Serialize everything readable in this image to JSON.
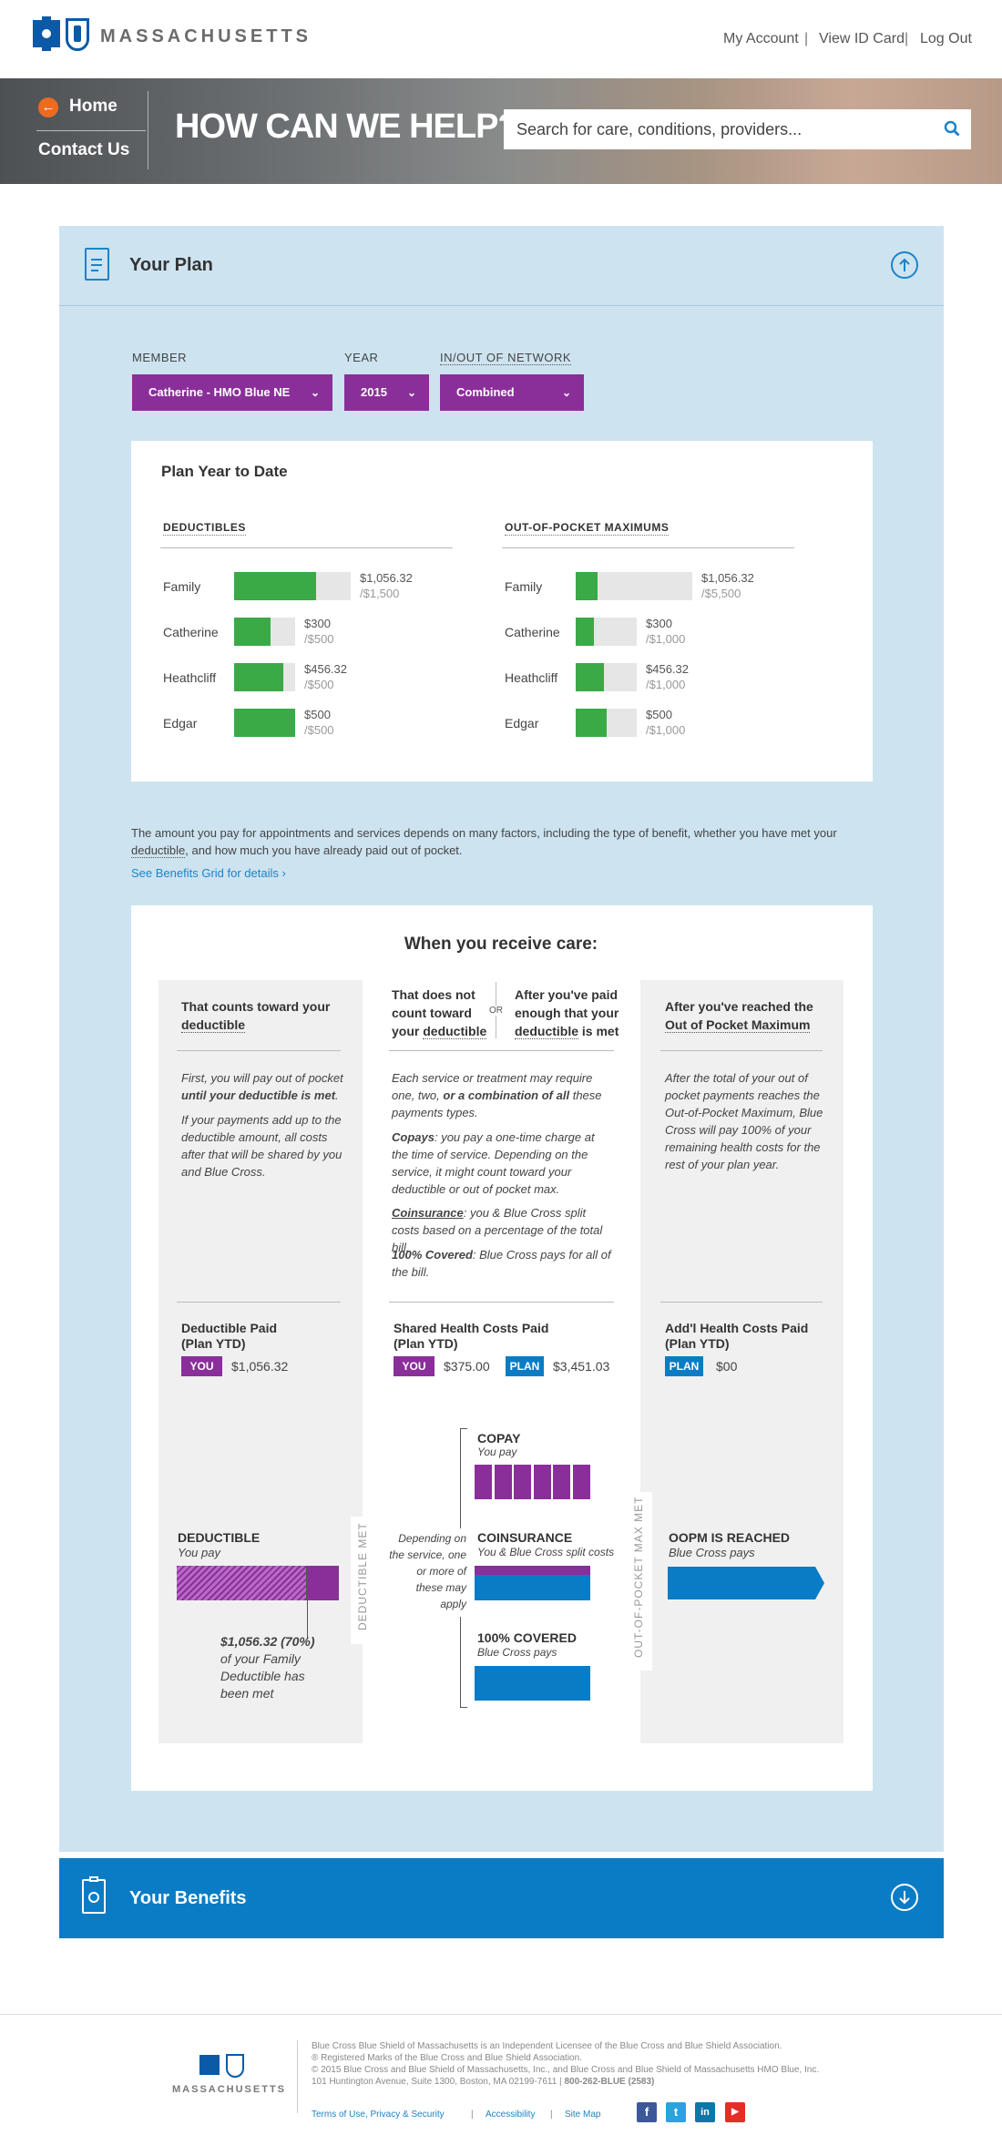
{
  "header": {
    "brand": "MASSACHUSETTS",
    "links": [
      "My Account",
      "View ID Card",
      "Log Out"
    ]
  },
  "hero": {
    "nav_home": "Home",
    "nav_contact": "Contact Us",
    "title": "HOW CAN WE HELP?",
    "search_placeholder": "Search for care, conditions, providers..."
  },
  "plan": {
    "title": "Your Plan",
    "filters": {
      "member_label": "MEMBER",
      "member_value": "Catherine - HMO Blue NE",
      "year_label": "YEAR",
      "year_value": "2015",
      "network_label": "IN/OUT OF NETWORK",
      "network_value": "Combined"
    },
    "ytd": {
      "title": "Plan Year to Date",
      "deductibles_title": "DEDUCTIBLES",
      "oop_title": "OUT-OF-POCKET MAXIMUMS",
      "deductibles": [
        {
          "name": "Family",
          "amount": "$1,056.32",
          "limit": "/$1,500",
          "fraction": 0.704
        },
        {
          "name": "Catherine",
          "amount": "$300",
          "limit": "/$500",
          "fraction": 0.6
        },
        {
          "name": "Heathcliff",
          "amount": "$456.32",
          "limit": "/$500",
          "fraction": 0.8
        },
        {
          "name": "Edgar",
          "amount": "$500",
          "limit": "/$500",
          "fraction": 1.0
        }
      ],
      "oop": [
        {
          "name": "Family",
          "amount": "$1,056.32",
          "limit": "/$5,500",
          "fraction": 0.19
        },
        {
          "name": "Catherine",
          "amount": "$300",
          "limit": "/$1,000",
          "fraction": 0.3
        },
        {
          "name": "Heathcliff",
          "amount": "$456.32",
          "limit": "/$1,000",
          "fraction": 0.46
        },
        {
          "name": "Edgar",
          "amount": "$500",
          "limit": "/$1,000",
          "fraction": 0.5
        }
      ]
    },
    "description_1": "The amount you pay for appointments and services depends on many factors, including the type of benefit, whether you have met your",
    "description_2_deductible": "deductible",
    "description_2_rest": ", and how much you have already paid out of pocket.",
    "benefits_link": "See Benefits Grid for details ›"
  },
  "care": {
    "title": "When you receive care:",
    "col1": {
      "head_1": "That counts toward your",
      "head_2": "deductible",
      "text_1a": "First, you will pay out of pocket",
      "text_1b": "until your deductible is met",
      "text_1c": ".",
      "text_2": "If your payments add up to the deductible amount, all costs after that will be shared by you and Blue Cross.",
      "paid_title_1": "Deductible Paid",
      "paid_title_2": "(Plan YTD)",
      "badge_you": "YOU",
      "you_value": "$1,056.32"
    },
    "col2": {
      "head_a1": "That does not",
      "head_a2": "count toward",
      "head_a3": "your",
      "head_a4": "deductible",
      "or": "OR",
      "head_b1": "After you've paid",
      "head_b2": "enough that your",
      "head_b3": "deductible",
      "head_b4": "is met",
      "text_1": "Each service or treatment may require one, two,",
      "text_1b": "or a combination of all",
      "text_1c": "these payments types.",
      "copays_label": "Copays",
      "copays_text": ": you pay a one-time charge at the time of service. Depending on the service, it might count toward your deductible or out of pocket max.",
      "coins_label": "Coinsurance",
      "coins_text": ": you & Blue Cross split costs based on a percentage of the total bill.",
      "covered_label": "100% Covered",
      "covered_text": ": Blue Cross pays for all of the bill.",
      "paid_title_1": "Shared Health Costs Paid",
      "paid_title_2": "(Plan YTD)",
      "badge_you": "YOU",
      "you_value": "$375.00",
      "badge_plan": "PLAN",
      "plan_value": "$3,451.03"
    },
    "col3": {
      "head_1": "After you've reached the",
      "head_2": "Out of Pocket Maximum",
      "text": "After the total of your out of pocket payments reaches the Out-of-Pocket Maximum, Blue Cross will pay 100% of your remaining health costs for the rest of your plan year.",
      "paid_title_1": "Add'l Health Costs Paid",
      "paid_title_2": "(Plan YTD)",
      "badge_plan": "PLAN",
      "plan_value": "$00"
    },
    "diagram": {
      "deductible_title": "DEDUCTIBLE",
      "deductible_sub": "You pay",
      "deductible_fraction": 0.8,
      "deductible_note_1": "$1,056.32 (70%)",
      "deductible_note_2": "of your Family",
      "deductible_note_3": "Deductible has",
      "deductible_note_4": "been met",
      "deductible_met_label": "DEDUCTIBLE MET",
      "depending_1": "Depending on",
      "depending_2": "the service, one",
      "depending_3": "or more of",
      "depending_4": "these may",
      "depending_5": "apply",
      "copay_title": "COPAY",
      "copay_sub": "You pay",
      "coins_title": "COINSURANCE",
      "coins_sub": "You & Blue Cross split costs",
      "covered_title": "100% COVERED",
      "covered_sub": "Blue Cross pays",
      "oop_met_label": "OUT-OF-POCKET MAX MET",
      "oopm_title": "OOPM IS REACHED",
      "oopm_sub": "Blue Cross pays"
    }
  },
  "benefits": {
    "title": "Your Benefits"
  },
  "footer": {
    "brand": "MASSACHUSETTS",
    "line_1": "Blue Cross Blue Shield of Massachusetts is an Independent Licensee of the Blue Cross and Blue Shield Association.",
    "line_2": "® Registered Marks of the Blue Cross and Blue Shield Association.",
    "line_3": "© 2015 Blue Cross and Blue Shield of Massachusetts, Inc., and Blue Cross and Blue Shield of Massachusetts HMO Blue, Inc.",
    "line_4": "101 Huntington Avenue, Suite 1300, Boston, MA 02199-7611 |",
    "phone": "800-262-BLUE (2583)",
    "links": [
      "Terms of Use, Privacy & Security",
      "Accessibility",
      "Site Map"
    ],
    "social": [
      "f",
      "t",
      "in",
      "▶"
    ]
  },
  "colors": {
    "purple": "#8a2f9a",
    "green": "#3aaa47",
    "blue": "#0a7cc5",
    "panel": "#cde3f0"
  }
}
